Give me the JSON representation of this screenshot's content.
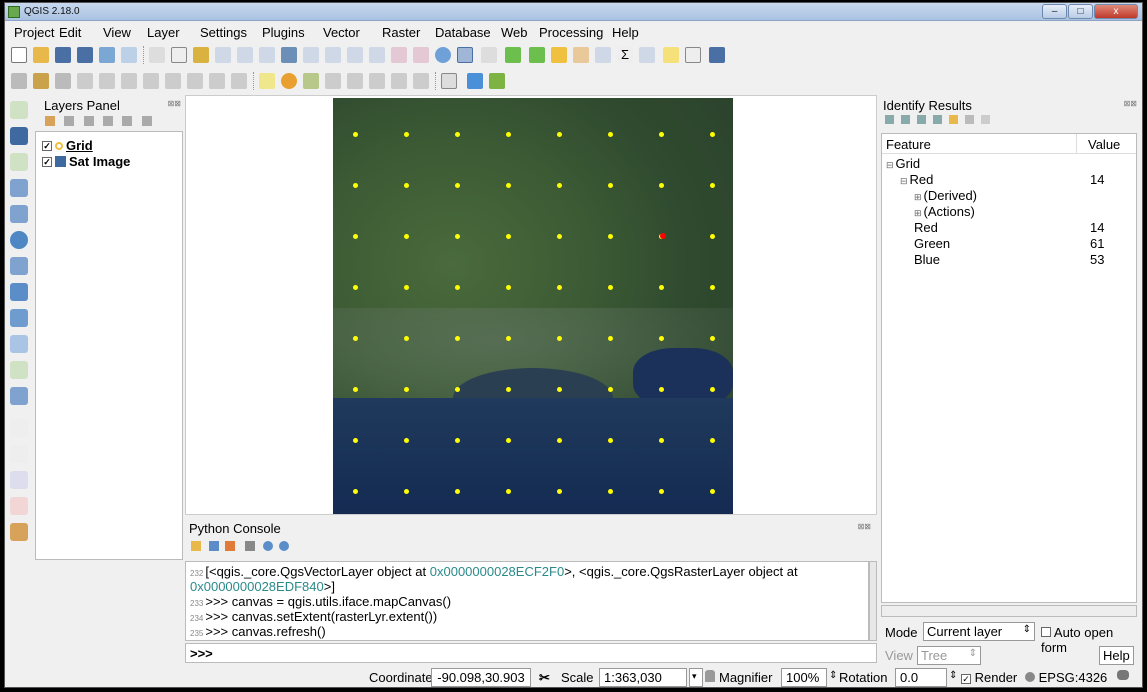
{
  "window": {
    "title": "QGIS 2.18.0",
    "controls": {
      "minimize": "–",
      "maximize": "□",
      "close": "x"
    }
  },
  "menu": [
    "Project",
    "Edit",
    "View",
    "Layer",
    "Settings",
    "Plugins",
    "Vector",
    "Raster",
    "Database",
    "Web",
    "Processing",
    "Help"
  ],
  "layers_panel": {
    "title": "Layers Panel",
    "layers": [
      {
        "name": "Grid",
        "checked": true,
        "icon": "point-layer-icon"
      },
      {
        "name": "Sat Image",
        "checked": true,
        "icon": "raster-layer-icon"
      }
    ]
  },
  "python_console": {
    "title": "Python Console",
    "lines": [
      {
        "num": "232",
        "parts": [
          "[<qgis._core.QgsVectorLayer object at ",
          "0x0000000028ECF2F0",
          ">, <qgis._core.QgsRasterLayer object at ",
          "0x0000000028EDF840",
          ">]"
        ]
      },
      {
        "num": "233",
        "text": ">>> canvas = qgis.utils.iface.mapCanvas()"
      },
      {
        "num": "234",
        "text": ">>> canvas.setExtent(rasterLyr.extent())"
      },
      {
        "num": "235",
        "text": ">>> canvas.refresh()"
      }
    ],
    "prompt": ">>>"
  },
  "identify": {
    "title": "Identify Results",
    "columns": [
      "Feature",
      "Value"
    ],
    "rows": [
      {
        "label": "Grid",
        "value": "",
        "indent": 0,
        "expander": "⊟"
      },
      {
        "label": "Red",
        "value": "14",
        "indent": 1,
        "expander": "⊟"
      },
      {
        "label": "(Derived)",
        "value": "",
        "indent": 2,
        "expander": "⊞"
      },
      {
        "label": "(Actions)",
        "value": "",
        "indent": 2,
        "expander": "⊞"
      },
      {
        "label": "Red",
        "value": "14",
        "indent": 2,
        "expander": ""
      },
      {
        "label": "Green",
        "value": "61",
        "indent": 2,
        "expander": ""
      },
      {
        "label": "Blue",
        "value": "53",
        "indent": 2,
        "expander": ""
      }
    ],
    "mode_label": "Mode",
    "mode_value": "Current layer",
    "auto_open": "Auto open form",
    "view_label": "View",
    "view_value": "Tree",
    "help": "Help"
  },
  "status": {
    "coordinate_label": "Coordinate",
    "coordinate": "-90.098,30.903",
    "scale_label": "Scale",
    "scale": "1:363,030",
    "magnifier_label": "Magnifier",
    "magnifier": "100%",
    "rotation_label": "Rotation",
    "rotation": "0.0",
    "render": "Render",
    "crs": "EPSG:4326"
  },
  "colors": {
    "grid_point": "#ffff00",
    "selected_point": "#ff0000",
    "address": "#2a8a8a"
  }
}
